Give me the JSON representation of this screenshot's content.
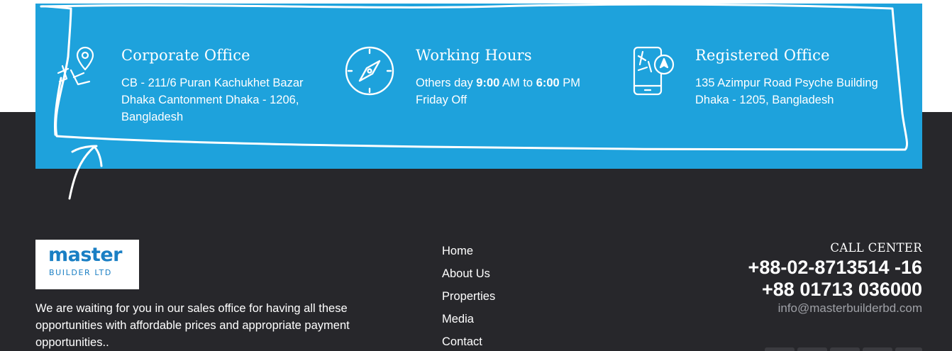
{
  "info_band": {
    "corporate": {
      "title": "Corporate Office",
      "line1": "CB - 211/6 Puran Kachukhet Bazar",
      "line2": "Dhaka Cantonment Dhaka - 1206,",
      "line3": "Bangladesh",
      "icon": "map-location-icon"
    },
    "hours": {
      "title": "Working Hours",
      "prefix": "Others day ",
      "open_time": "9:00",
      "mid": " AM to ",
      "close_time": "6:00",
      "suffix": " PM",
      "line2": "Friday Off",
      "icon": "compass-icon"
    },
    "registered": {
      "title": "Registered Office",
      "line1": "135 Azimpur Road Psyche Building",
      "line2": "Dhaka - 1205, Bangladesh",
      "icon": "phone-map-icon"
    }
  },
  "footer": {
    "logo": {
      "word": "master",
      "sub": "BUILDER LTD"
    },
    "about": "We are waiting for you in our sales office for having all these opportunities with affordable prices and appropriate payment opportunities..",
    "nav": [
      "Home",
      "About Us",
      "Properties",
      "Media",
      "Contact"
    ],
    "call_center": {
      "label": "CALL CENTER",
      "phone1": "+88-02-8713514 -16",
      "phone2": "+88 01713 036000",
      "email": "info@masterbuilderbd.com"
    }
  },
  "colors": {
    "band": "#1ea2dc",
    "footer": "#27272b",
    "accent": "#1a7fc4"
  }
}
